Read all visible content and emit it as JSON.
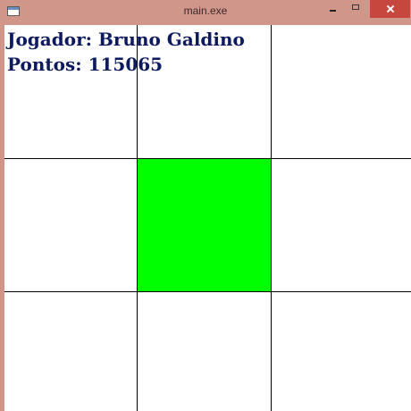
{
  "window": {
    "title": "main.exe"
  },
  "hud": {
    "player_label": "Jogador:",
    "player_name": "Bruno Galdino",
    "points_label": "Pontos:",
    "points_value": "115065"
  },
  "grid": {
    "rows": 3,
    "cols": 3,
    "active_cell": {
      "row": 2,
      "col": 2
    },
    "active_color": "#00ff00",
    "line_color": "#000000",
    "background_color": "#ffffff"
  },
  "colors": {
    "titlebar": "#d0968a",
    "close_button": "#c7463e",
    "hud_text": "#0d1a5e"
  },
  "icons": [
    "app-window-icon",
    "minimize-icon",
    "maximize-icon",
    "close-icon"
  ]
}
